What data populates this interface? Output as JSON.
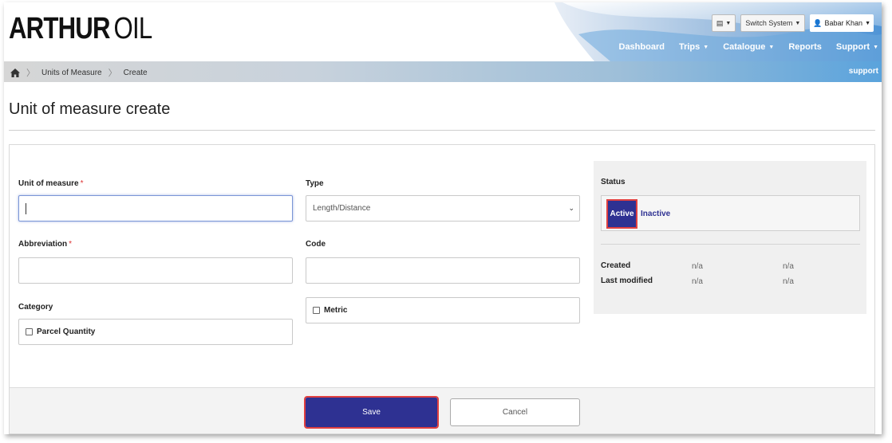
{
  "header": {
    "logo_bold": "ARTHUR",
    "logo_light": "OIL",
    "switch_system": "Switch System",
    "user_name": "Babar Khan"
  },
  "nav": {
    "items": [
      {
        "label": "Dashboard",
        "has_menu": false
      },
      {
        "label": "Trips",
        "has_menu": true
      },
      {
        "label": "Catalogue",
        "has_menu": true
      },
      {
        "label": "Reports",
        "has_menu": false
      },
      {
        "label": "Support",
        "has_menu": true
      }
    ]
  },
  "breadcrumb": {
    "items": [
      "Units of Measure",
      "Create"
    ],
    "support_link": "support"
  },
  "page": {
    "title": "Unit of measure create"
  },
  "form": {
    "unit_of_measure": {
      "label": "Unit of measure",
      "required": "*",
      "value": ""
    },
    "abbreviation": {
      "label": "Abbreviation",
      "required": "*",
      "value": ""
    },
    "category": {
      "label": "Category",
      "checkbox_label": "Parcel Quantity",
      "checked": false
    },
    "type": {
      "label": "Type",
      "selected": "Length/Distance"
    },
    "code": {
      "label": "Code",
      "value": ""
    },
    "metric": {
      "checkbox_label": "Metric",
      "checked": false
    }
  },
  "status": {
    "label": "Status",
    "active_label": "Active",
    "inactive_label": "Inactive",
    "selected": "Active",
    "created_label": "Created",
    "created_by": "n/a",
    "created_at": "n/a",
    "modified_label": "Last modified",
    "modified_by": "n/a",
    "modified_at": "n/a"
  },
  "actions": {
    "save_label": "Save",
    "cancel_label": "Cancel"
  },
  "colors": {
    "primary": "#2e3192",
    "highlight": "#e04040",
    "nav_blue": "#5aa3dc"
  }
}
